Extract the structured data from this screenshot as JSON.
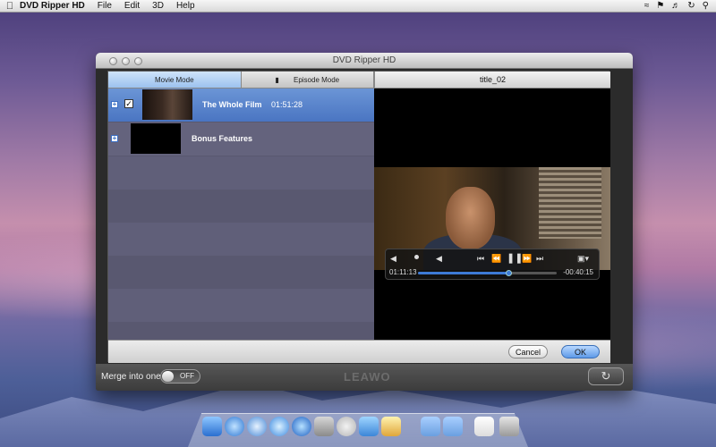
{
  "menubar": {
    "app_name": "DVD Ripper HD",
    "menus": [
      "File",
      "Edit",
      "3D",
      "Help"
    ],
    "icons": [
      "apple-icon",
      "wifi-icon",
      "flag-icon",
      "volume-icon",
      "sync-icon",
      "spotlight-icon"
    ]
  },
  "window": {
    "title": "DVD Ripper HD",
    "merge_label": "Merge into one",
    "merge_toggle": "OFF",
    "brand": "LEAWO"
  },
  "dialog": {
    "tabs": [
      {
        "label": "Movie Mode",
        "active": true
      },
      {
        "label": "Episode Mode",
        "active": false
      }
    ],
    "preview_title": "title_02",
    "rows": [
      {
        "title": "The Whole Film",
        "duration": "01:51:28",
        "checked": true,
        "selected": true
      },
      {
        "title": "Bonus Features",
        "duration": "",
        "checked": false,
        "selected": false
      }
    ],
    "cancel_label": "Cancel",
    "ok_label": "OK"
  },
  "player": {
    "elapsed": "01:11:13",
    "remaining": "-00:40:15",
    "progress": 0.65
  },
  "colors": {
    "selection": "#4a75c2",
    "list_bg": "#595870",
    "progress": "#3d7ad6"
  }
}
